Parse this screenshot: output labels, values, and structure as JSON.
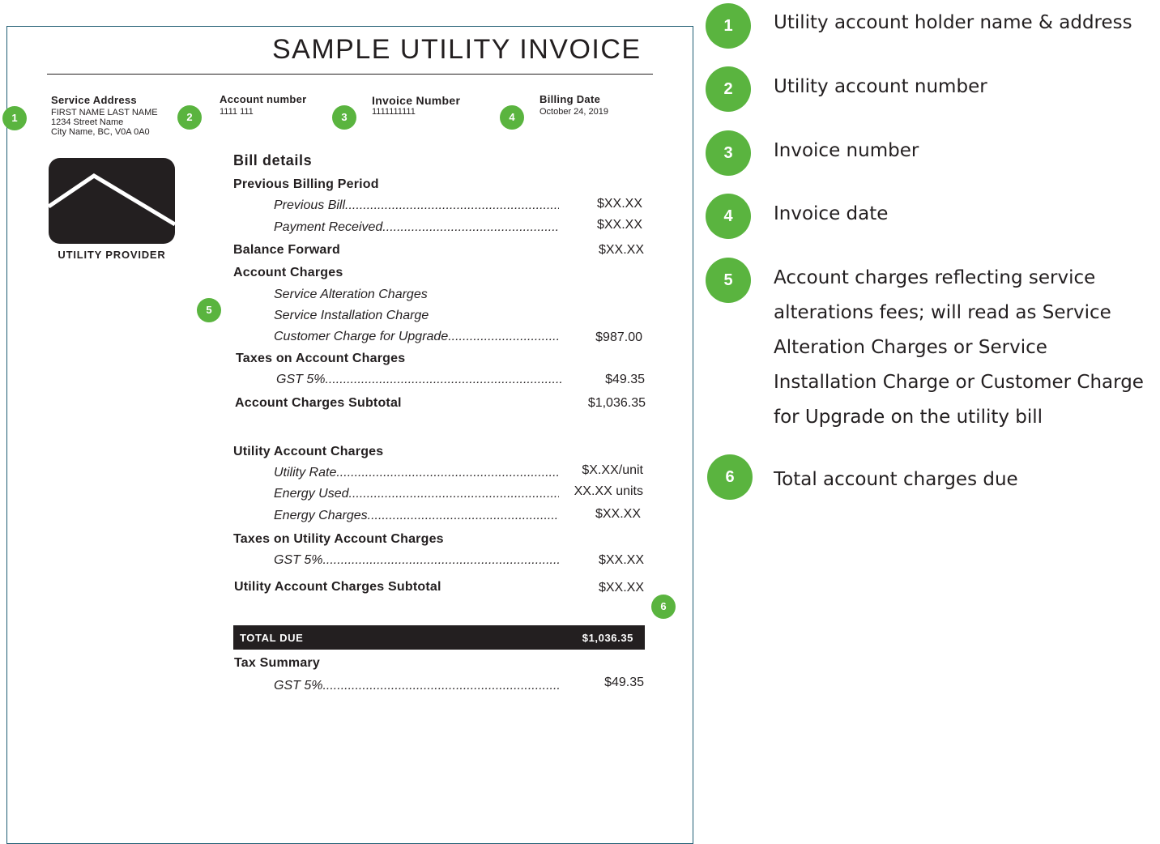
{
  "invoice": {
    "title": "SAMPLE UTILITY INVOICE",
    "service_address_label": "Service Address",
    "service_address_lines": [
      "FIRST NAME LAST NAME",
      "1234 Street Name",
      "City Name, BC, V0A 0A0"
    ],
    "account_number_label": "Account number",
    "account_number": "1111 111",
    "invoice_number_label": "Invoice Number",
    "invoice_number": "1111111111",
    "billing_date_label": "Billing Date",
    "billing_date": "October 24, 2019",
    "provider_name": "UTILITY PROVIDER",
    "bill_details_heading": "Bill details",
    "previous_period": {
      "heading": "Previous Billing Period",
      "items": [
        {
          "label": "Previous Bill",
          "amount": "$XX.XX"
        },
        {
          "label": "Payment Received",
          "amount": "$XX.XX"
        }
      ]
    },
    "balance_forward": {
      "label": "Balance Forward",
      "amount": "$XX.XX"
    },
    "account_charges": {
      "heading": "Account Charges",
      "items": [
        {
          "label": "Service Alteration Charges",
          "amount": ""
        },
        {
          "label": "Service Installation Charge",
          "amount": ""
        },
        {
          "label": "Customer Charge for Upgrade",
          "amount": "$987.00"
        }
      ]
    },
    "taxes_account": {
      "heading": "Taxes on Account Charges",
      "items": [
        {
          "label": "GST 5%",
          "amount": "$49.35"
        }
      ]
    },
    "account_subtotal": {
      "label": "Account Charges Subtotal",
      "amount": "$1,036.35"
    },
    "utility_charges": {
      "heading": "Utility Account Charges",
      "items": [
        {
          "label": "Utility Rate",
          "amount": "$X.XX/unit"
        },
        {
          "label": "Energy Used",
          "amount": "XX.XX units"
        },
        {
          "label": "Energy Charges",
          "amount": "$XX.XX"
        }
      ]
    },
    "taxes_utility": {
      "heading": "Taxes on Utility Account Charges",
      "items": [
        {
          "label": "GST 5%",
          "amount": "$XX.XX"
        }
      ]
    },
    "utility_subtotal": {
      "label": "Utility Account Charges Subtotal",
      "amount": "$XX.XX"
    },
    "total_due": {
      "label": "TOTAL DUE",
      "amount": "$1,036.35"
    },
    "tax_summary": {
      "heading": "Tax Summary",
      "items": [
        {
          "label": "GST 5%",
          "amount": "$49.35"
        }
      ]
    }
  },
  "markers": [
    "1",
    "2",
    "3",
    "4",
    "5",
    "6"
  ],
  "legend": [
    {
      "number": "1",
      "text": "Utility account holder name & address"
    },
    {
      "number": "2",
      "text": "Utility account number"
    },
    {
      "number": "3",
      "text": "Invoice number"
    },
    {
      "number": "4",
      "text": "Invoice date"
    },
    {
      "number": "5",
      "text": "Account charges reflecting service alterations fees; will read as Service Alteration Charges or Service Installation Charge or Customer Charge for Upgrade on the utility bill"
    },
    {
      "number": "6",
      "text": "Total account charges due"
    }
  ],
  "colors": {
    "marker_green": "#5ab43f",
    "dark": "#231f20",
    "frame_border": "#1f5d73"
  },
  "icons": {
    "logo": "house-roof-logo-icon"
  }
}
